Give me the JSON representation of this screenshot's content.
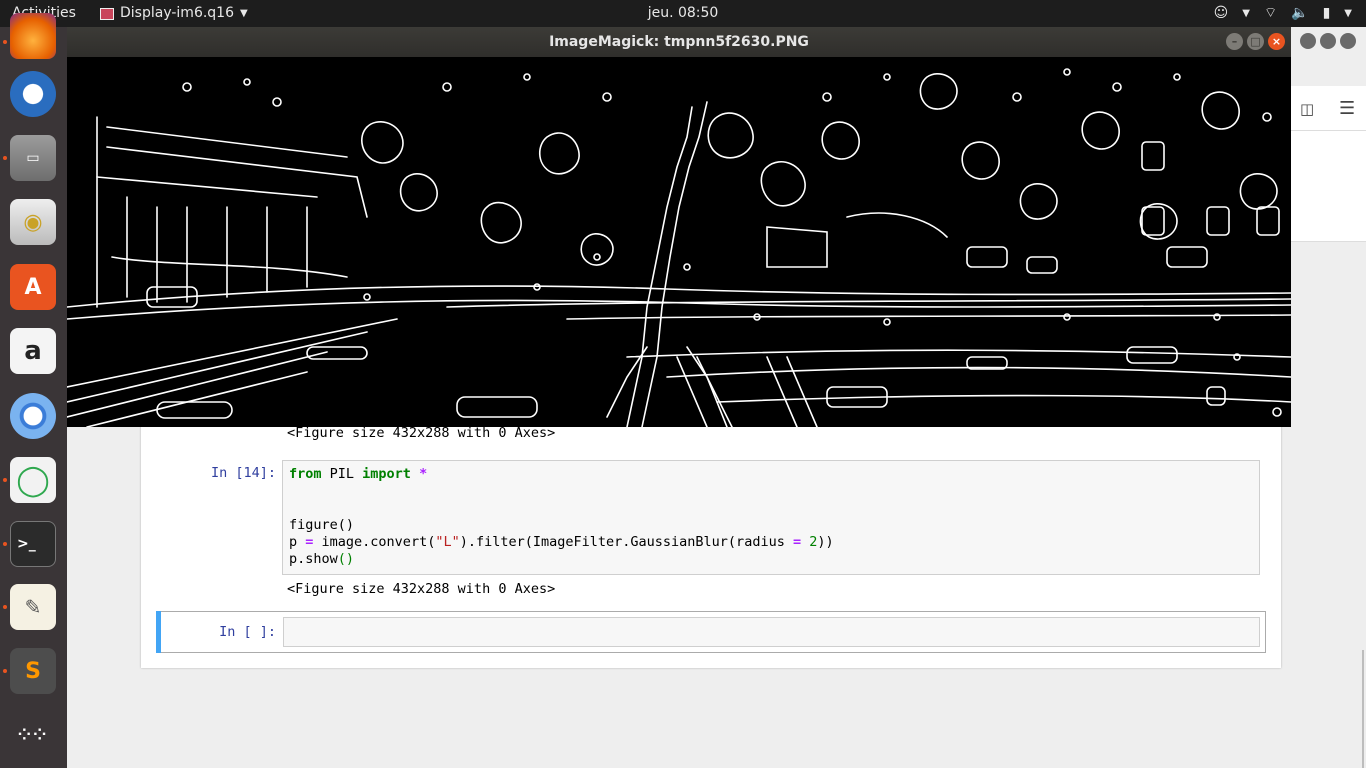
{
  "topbar": {
    "activities": "Activities",
    "app_name": "Display-im6.q16",
    "clock": "jeu. 08:50"
  },
  "dock": {
    "items": [
      {
        "name": "firefox-icon",
        "color": "#e66000"
      },
      {
        "name": "thunderbird-icon",
        "color": "#2a6dbf"
      },
      {
        "name": "files-icon",
        "color": "#8a8a8a"
      },
      {
        "name": "rhythmbox-icon",
        "color": "#d9b43a"
      },
      {
        "name": "software-center-icon",
        "color": "#e95420"
      },
      {
        "name": "amazon-icon",
        "color": "#ffffff"
      },
      {
        "name": "chromium-icon",
        "color": "#3b7dd8"
      },
      {
        "name": "app-green-icon",
        "color": "#2fa84f"
      },
      {
        "name": "terminal-icon",
        "color": "#2b2b2b"
      },
      {
        "name": "text-editor-icon",
        "color": "#f2f2f2"
      },
      {
        "name": "sublime-text-icon",
        "color": "#4d4d4d"
      },
      {
        "name": "show-applications-icon",
        "color": "#3a3537"
      }
    ]
  },
  "imagemagick": {
    "title": "ImageMagick: tmpnn5f2630.PNG"
  },
  "notebook": {
    "output_1": "<Figure size 432x288 with 0 Axes>",
    "cell_14": {
      "prompt": "In [14]:",
      "line1_kw1": "from",
      "line1_mod": " PIL ",
      "line1_kw2": "import",
      "line1_star": " *",
      "line4": "figure()",
      "line5_p": "p ",
      "line5_eq": "=",
      "line5_a": " image.convert(",
      "line5_str": "\"L\"",
      "line5_b": ").filter(ImageFilter.GaussianBlur(radius ",
      "line5_eq2": "=",
      "line5_num": " 2",
      "line5_c": "))",
      "line6_a": "p.show",
      "line6_b": "()"
    },
    "output_2": "<Figure size 432x288 with 0 Axes>",
    "empty_cell_prompt": "In [ ]:"
  }
}
